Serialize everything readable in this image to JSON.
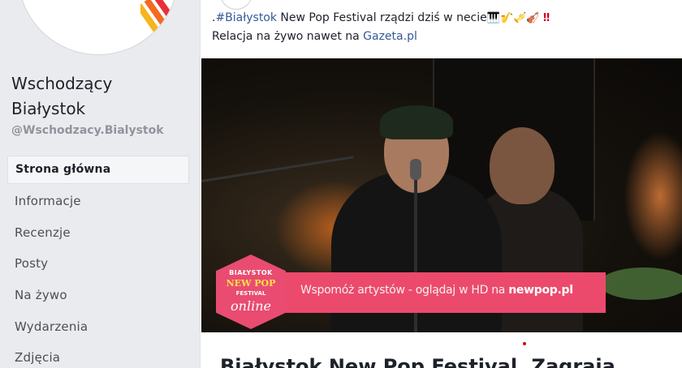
{
  "sidebar": {
    "page_name": "Wschodzący Białystok",
    "page_handle": "@Wschodzacy.Bialystok",
    "items": [
      {
        "label": "Strona główna",
        "active": true
      },
      {
        "label": "Informacje"
      },
      {
        "label": "Recenzje"
      },
      {
        "label": "Posty"
      },
      {
        "label": "Na żywo"
      },
      {
        "label": "Wydarzenia"
      },
      {
        "label": "Zdjęcia"
      }
    ]
  },
  "post": {
    "text_prefix": ".",
    "hashtag": "#Białystok",
    "text_line1": " New Pop Festival rządzi dziś w necie",
    "emojis": [
      "🎹",
      "🎷",
      "🎺",
      "🎻",
      "‼"
    ],
    "text_line2": "Relacja na żywo nawet na ",
    "link": "Gazeta.pl",
    "video": {
      "badge_line1": "BIAŁYSTOK",
      "badge_line2": "NEW POP",
      "badge_line3": "FESTIVAL",
      "badge_line4": "online",
      "banner_text": "Wspomóż artystów - oglądaj w HD na ",
      "banner_link": "newpop.pl"
    },
    "headline": "Białystok New Pop Festival. Zagraja..."
  },
  "colors": {
    "link": "#365899",
    "banner": "#ec4a6c",
    "background": "#e9ebee"
  }
}
